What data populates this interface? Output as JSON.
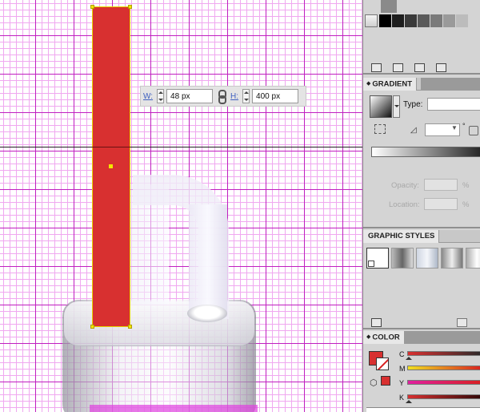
{
  "canvas": {
    "selected_fill": "#d83030",
    "selection_color": "#e6d400",
    "grid_color": "#c020c0"
  },
  "transform": {
    "width_label": "W:",
    "width_value": "48 px",
    "height_label": "H:",
    "height_value": "400 px"
  },
  "gradient": {
    "tab_label": "GRADIENT",
    "type_label": "Type:",
    "type_value": "",
    "angle_value": "",
    "degree_symbol": "°",
    "opacity_label": "Opacity:",
    "location_label": "Location:",
    "percent": "%"
  },
  "graphic_styles": {
    "tab_label": "GRAPHIC STYLES"
  },
  "color": {
    "tab_label": "COLOR",
    "fill": "#d83030",
    "channels": [
      "C",
      "M",
      "Y",
      "K"
    ]
  },
  "icons": {
    "link": "chain-link-icon",
    "reverse": "reverse-gradient-icon",
    "angle": "angle-icon",
    "cube": "out-of-gamut-cube-icon"
  }
}
